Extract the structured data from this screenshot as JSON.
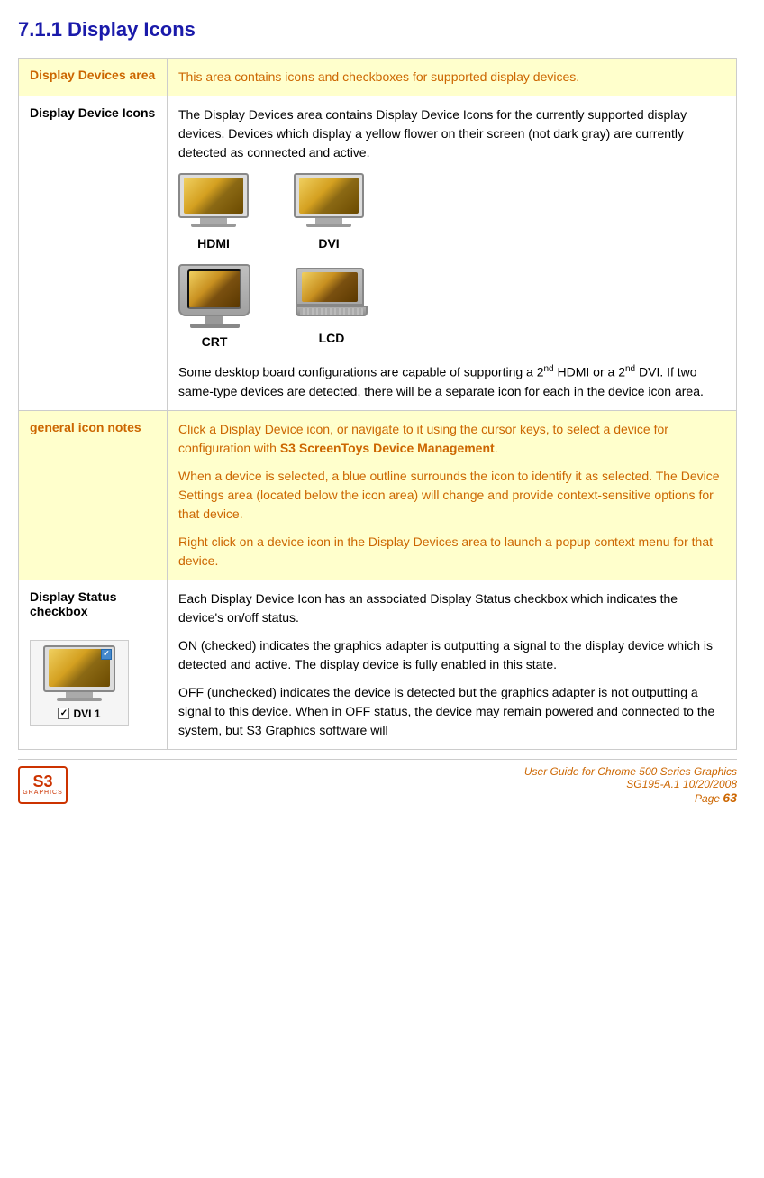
{
  "page": {
    "title": "7.1.1 Display Icons"
  },
  "rows": [
    {
      "id": "display-devices-area",
      "label": "Display Devices area",
      "highlight": true,
      "content": "This area contains icons and checkboxes for supported display devices."
    },
    {
      "id": "display-device-icons",
      "label": "Display Device Icons",
      "highlight": false,
      "content_paragraphs": [
        "The Display Devices area contains Display Device Icons for the currently supported display devices. Devices which display a yellow flower on their screen (not dark gray) are currently detected as connected and active."
      ],
      "icon_labels": [
        "HDMI",
        "DVI",
        "CRT",
        "LCD"
      ],
      "trailing_text": "Some desktop board configurations are capable of supporting a 2nd HDMI or a 2nd DVI. If two same-type devices are detected, there will be a separate icon for each in the device icon area."
    },
    {
      "id": "general-icon-notes",
      "label": "general icon notes",
      "highlight": true,
      "paragraphs": [
        "Click a Display Device icon, or navigate to it using the cursor keys, to select a device for configuration with S3 ScreenToys Device Management.",
        "When a device is selected, a blue outline surrounds the icon to identify it as selected. The Device Settings area (located below the icon area) will change and provide context-sensitive options for that device.",
        "Right click on a device icon in the Display Devices area to launch a popup context menu for that device."
      ],
      "bold_phrase": "S3 ScreenToys Device Management"
    },
    {
      "id": "display-status-checkbox",
      "label": "Display Status checkbox",
      "highlight": false,
      "paragraphs": [
        "Each Display Device Icon has an associated Display Status checkbox which indicates the device's on/off status.",
        "ON (checked) indicates the graphics adapter is outputting a signal to the display device which is detected and active. The display device is fully enabled in this state.",
        "OFF (unchecked) indicates the device is detected but the graphics adapter is not outputting a signal to this device. When in OFF status, the device may remain powered and connected to the system, but S3 Graphics software will"
      ],
      "status_icon_label": "DVI 1"
    }
  ],
  "footer": {
    "guide_text": "User Guide for Chrome 500 Series Graphics",
    "doc_id": "SG195-A.1   10/20/2008",
    "page_label": "Page",
    "page_number": "63"
  }
}
